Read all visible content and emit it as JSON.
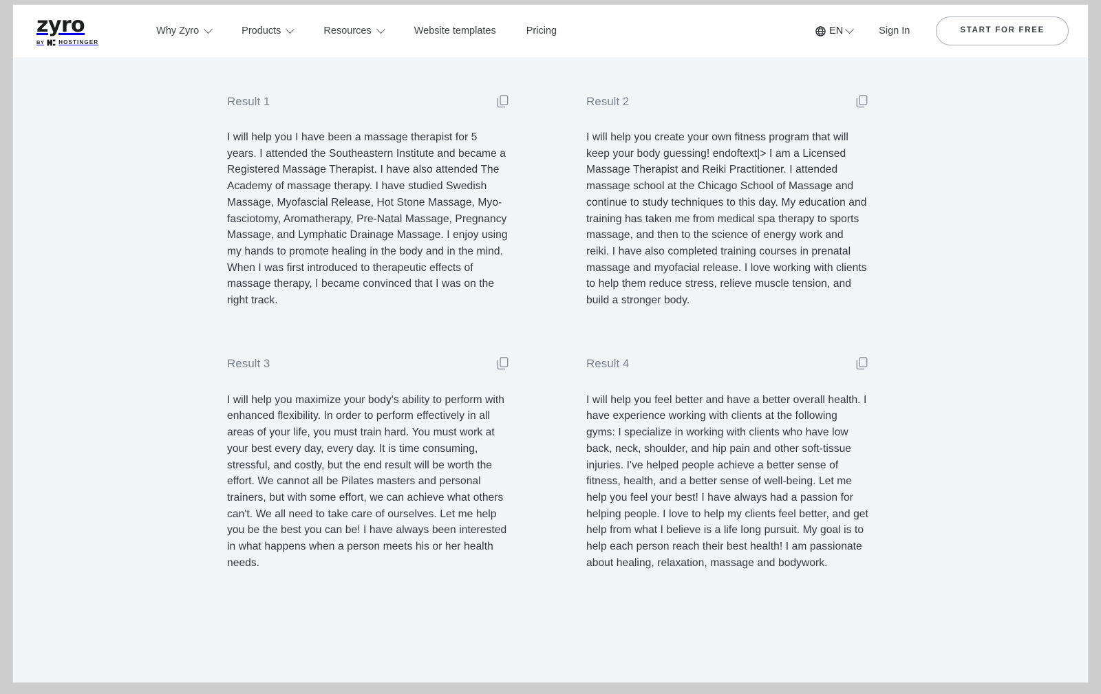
{
  "header": {
    "logo": {
      "word": "zyro",
      "by_label": "BY",
      "parent_brand": "HOSTINGER",
      "mark_icon": "hostinger-mark-icon"
    },
    "nav_items": [
      {
        "label": "Why Zyro",
        "has_dropdown": true,
        "icon": "chevron-down-icon"
      },
      {
        "label": "Products",
        "has_dropdown": true,
        "icon": "chevron-down-icon"
      },
      {
        "label": "Resources",
        "has_dropdown": true,
        "icon": "chevron-down-icon"
      },
      {
        "label": "Website templates",
        "has_dropdown": false
      },
      {
        "label": "Pricing",
        "has_dropdown": false
      }
    ],
    "language": {
      "code": "EN",
      "globe_icon": "globe-icon",
      "chevron_icon": "chevron-down-icon"
    },
    "sign_in_label": "Sign In",
    "cta_label": "START FOR FREE"
  },
  "colors": {
    "page_background": "#f2f5f8",
    "header_background": "#ffffff",
    "outer_frame": "#cdcdcd",
    "body_text": "#32373d",
    "muted_text": "#7c848e",
    "nav_text": "#3c3f44",
    "cta_border": "#a9adb3"
  },
  "results": [
    {
      "title": "Result 1",
      "copy_icon": "copy-icon",
      "text": "I will help you I have been a massage therapist for 5 years. I attended the Southeastern Institute and became a Registered Massage Therapist. I have also attended The Academy of massage therapy. I have studied Swedish Massage, Myofascial Release, Hot Stone Massage, Myo-fasciotomy, Aromatherapy, Pre-Natal Massage, Pregnancy Massage, and Lymphatic Drainage Massage. I enjoy using my hands to promote healing in the body and in the mind. When I was first introduced to therapeutic effects of massage therapy, I became convinced that I was on the right track."
    },
    {
      "title": "Result 2",
      "copy_icon": "copy-icon",
      "text": "I will help you create your own fitness program that will keep your body guessing! endoftext|> I am a Licensed Massage Therapist and Reiki Practitioner. I attended massage school at the Chicago School of Massage and continue to study techniques to this day. My education and training has taken me from medical spa therapy to sports massage, and then to the science of energy work and reiki. I have also completed training courses in prenatal massage and myofacial release. I love working with clients to help them reduce stress, relieve muscle tension, and build a stronger body."
    },
    {
      "title": "Result 3",
      "copy_icon": "copy-icon",
      "text": "I will help you maximize your body's ability to perform with enhanced flexibility. In order to perform effectively in all areas of your life, you must train hard. You must work at your best every day, every day. It is time consuming, stressful, and costly, but the end result will be worth the effort. We cannot all be Pilates masters and personal trainers, but with some effort, we can achieve what others can't. We all need to take care of ourselves. Let me help you be the best you can be! I have always been interested in what happens when a person meets his or her health needs."
    },
    {
      "title": "Result 4",
      "copy_icon": "copy-icon",
      "text": "I will help you feel better and have a better overall health. I have experience working with clients at the following gyms: I specialize in working with clients who have low back, neck, shoulder, and hip pain and other soft-tissue injuries. I've helped people achieve a better sense of fitness, health, and a better sense of well-being. Let me help you feel your best! I have always had a passion for helping people. I love to help my clients feel better, and get help from what I believe is a life long pursuit. My goal is to help each person reach their best health! I am passionate about healing, relaxation, massage and bodywork."
    }
  ]
}
